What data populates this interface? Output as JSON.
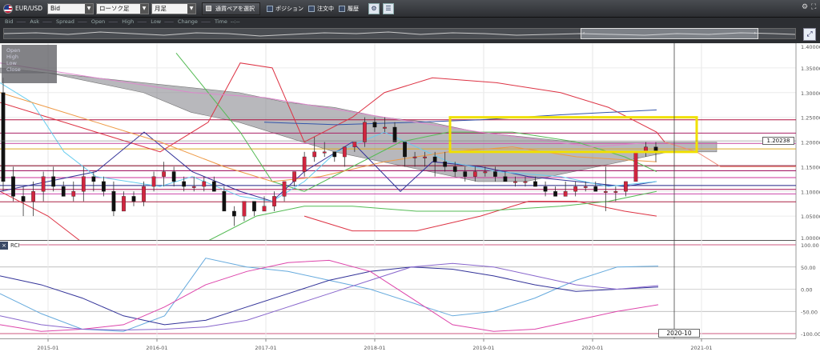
{
  "toolbar": {
    "symbol": "EUR/USD",
    "price_type": "Bid",
    "chart_style": "ローソク足",
    "period": "月足",
    "pair_button": "通貨ペアを選択",
    "checkboxes": [
      "ポジション",
      "注文中",
      "履歴"
    ]
  },
  "legend": [
    "Bid",
    "Ask",
    "Spread",
    "Open",
    "High",
    "Low",
    "Change",
    "Time"
  ],
  "legend_time_value": "--:--",
  "ohlc_labels": [
    "Open",
    "High",
    "Low",
    "Close"
  ],
  "price_tag": "1.20238",
  "rci_label": "RCI",
  "date_tag": "2020-10",
  "colors": {
    "bull": "#d0253f",
    "bear": "#111111",
    "cloud": "#8d8d93",
    "highlight": "#f0e000",
    "kijun": "#333399",
    "tenkan": "#66ccee",
    "bb_outer": "#dd3344",
    "bb_mid": "#55bb55"
  },
  "chart_data": [
    {
      "type": "candlestick",
      "symbol": "EUR/USD",
      "period": "monthly",
      "ylim": [
        1.0,
        1.4
      ],
      "y_ticks": [
        "1.40000",
        "1.35000",
        "1.30000",
        "1.25000",
        "1.20000",
        "1.15000",
        "1.10000",
        "1.05000",
        "1.00000"
      ],
      "x_ticks": [
        "2015-01",
        "2016-01",
        "2017-01",
        "2018-01",
        "2019-01",
        "2020-01",
        "2021-01"
      ],
      "last_price": 1.20238,
      "cursor_date": "2020-10",
      "candles": [
        [
          1.3,
          1.33,
          1.1,
          1.12
        ],
        [
          1.13,
          1.15,
          1.08,
          1.09
        ],
        [
          1.09,
          1.11,
          1.05,
          1.08
        ],
        [
          1.08,
          1.12,
          1.05,
          1.1
        ],
        [
          1.1,
          1.14,
          1.08,
          1.13
        ],
        [
          1.13,
          1.15,
          1.1,
          1.11
        ],
        [
          1.11,
          1.12,
          1.09,
          1.09
        ],
        [
          1.09,
          1.12,
          1.08,
          1.1
        ],
        [
          1.1,
          1.15,
          1.08,
          1.13
        ],
        [
          1.13,
          1.14,
          1.1,
          1.12
        ],
        [
          1.12,
          1.13,
          1.09,
          1.1
        ],
        [
          1.1,
          1.12,
          1.05,
          1.06
        ],
        [
          1.06,
          1.1,
          1.06,
          1.09
        ],
        [
          1.09,
          1.1,
          1.07,
          1.08
        ],
        [
          1.08,
          1.12,
          1.07,
          1.11
        ],
        [
          1.11,
          1.14,
          1.1,
          1.13
        ],
        [
          1.13,
          1.16,
          1.11,
          1.14
        ],
        [
          1.14,
          1.15,
          1.11,
          1.12
        ],
        [
          1.12,
          1.13,
          1.1,
          1.11
        ],
        [
          1.11,
          1.13,
          1.1,
          1.11
        ],
        [
          1.11,
          1.13,
          1.1,
          1.12
        ],
        [
          1.12,
          1.13,
          1.1,
          1.1
        ],
        [
          1.1,
          1.11,
          1.06,
          1.06
        ],
        [
          1.06,
          1.07,
          1.03,
          1.05
        ],
        [
          1.05,
          1.08,
          1.04,
          1.08
        ],
        [
          1.08,
          1.08,
          1.05,
          1.06
        ],
        [
          1.06,
          1.09,
          1.06,
          1.07
        ],
        [
          1.07,
          1.1,
          1.06,
          1.09
        ],
        [
          1.09,
          1.12,
          1.08,
          1.12
        ],
        [
          1.12,
          1.14,
          1.11,
          1.14
        ],
        [
          1.14,
          1.18,
          1.13,
          1.17
        ],
        [
          1.17,
          1.21,
          1.16,
          1.18
        ],
        [
          1.18,
          1.2,
          1.17,
          1.18
        ],
        [
          1.18,
          1.18,
          1.16,
          1.17
        ],
        [
          1.17,
          1.19,
          1.15,
          1.19
        ],
        [
          1.19,
          1.2,
          1.18,
          1.2
        ],
        [
          1.2,
          1.25,
          1.19,
          1.24
        ],
        [
          1.24,
          1.25,
          1.22,
          1.23
        ],
        [
          1.23,
          1.25,
          1.22,
          1.23
        ],
        [
          1.23,
          1.24,
          1.2,
          1.2
        ],
        [
          1.2,
          1.2,
          1.15,
          1.17
        ],
        [
          1.17,
          1.18,
          1.15,
          1.17
        ],
        [
          1.17,
          1.18,
          1.15,
          1.17
        ],
        [
          1.17,
          1.18,
          1.13,
          1.16
        ],
        [
          1.16,
          1.18,
          1.14,
          1.15
        ],
        [
          1.15,
          1.16,
          1.13,
          1.14
        ],
        [
          1.14,
          1.15,
          1.12,
          1.13
        ],
        [
          1.13,
          1.15,
          1.12,
          1.14
        ],
        [
          1.14,
          1.15,
          1.13,
          1.14
        ],
        [
          1.14,
          1.15,
          1.12,
          1.13
        ],
        [
          1.13,
          1.14,
          1.12,
          1.12
        ],
        [
          1.12,
          1.13,
          1.11,
          1.12
        ],
        [
          1.12,
          1.13,
          1.11,
          1.12
        ],
        [
          1.12,
          1.13,
          1.11,
          1.11
        ],
        [
          1.11,
          1.12,
          1.09,
          1.1
        ],
        [
          1.1,
          1.11,
          1.09,
          1.09
        ],
        [
          1.09,
          1.12,
          1.09,
          1.1
        ],
        [
          1.1,
          1.12,
          1.09,
          1.11
        ],
        [
          1.11,
          1.12,
          1.1,
          1.11
        ],
        [
          1.11,
          1.12,
          1.1,
          1.1
        ],
        [
          1.1,
          1.15,
          1.06,
          1.1
        ],
        [
          1.1,
          1.11,
          1.08,
          1.1
        ],
        [
          1.1,
          1.12,
          1.09,
          1.12
        ],
        [
          1.12,
          1.18,
          1.12,
          1.18
        ],
        [
          1.18,
          1.2,
          1.17,
          1.19
        ],
        [
          1.19,
          1.2,
          1.16,
          1.18
        ]
      ],
      "indicators": {
        "ichimoku_cloud_top": [
          1.35,
          1.34,
          1.33,
          1.32,
          1.31,
          1.3,
          1.28,
          1.27,
          1.25,
          1.24,
          1.22,
          1.21,
          1.2,
          1.2,
          1.2,
          1.2
        ],
        "ichimoku_cloud_bottom": [
          1.34,
          1.34,
          1.32,
          1.3,
          1.26,
          1.24,
          1.21,
          1.18,
          1.16,
          1.14,
          1.12,
          1.12,
          1.14,
          1.16,
          1.18,
          1.18
        ],
        "horizontal_lines": [
          1.245,
          1.218,
          1.197,
          1.186,
          1.152,
          1.142,
          1.128,
          1.112,
          1.104,
          1.095,
          1.079
        ]
      },
      "highlight_box": {
        "y_range": [
          1.18,
          1.25
        ]
      }
    },
    {
      "type": "line",
      "title": "RCI",
      "ylim": [
        -100,
        100
      ],
      "y_ticks": [
        "100.00",
        "50.00",
        "0.00",
        "-50.00",
        "-100.00"
      ],
      "series": [
        {
          "values": [
            -10,
            -55,
            -90,
            -95,
            -60,
            70,
            50,
            40,
            20,
            0,
            -30,
            -60,
            -50,
            -20,
            20,
            50,
            52
          ]
        },
        {
          "values": [
            30,
            10,
            -20,
            -60,
            -80,
            -70,
            -40,
            -10,
            20,
            40,
            50,
            45,
            30,
            10,
            -5,
            0,
            5
          ]
        },
        {
          "values": [
            -80,
            -95,
            -90,
            -80,
            -40,
            10,
            40,
            60,
            65,
            40,
            -20,
            -80,
            -95,
            -90,
            -70,
            -50,
            -35
          ]
        },
        {
          "values": [
            -60,
            -80,
            -90,
            -92,
            -90,
            -85,
            -70,
            -40,
            -10,
            20,
            50,
            58,
            50,
            30,
            10,
            0,
            8
          ]
        }
      ]
    }
  ]
}
